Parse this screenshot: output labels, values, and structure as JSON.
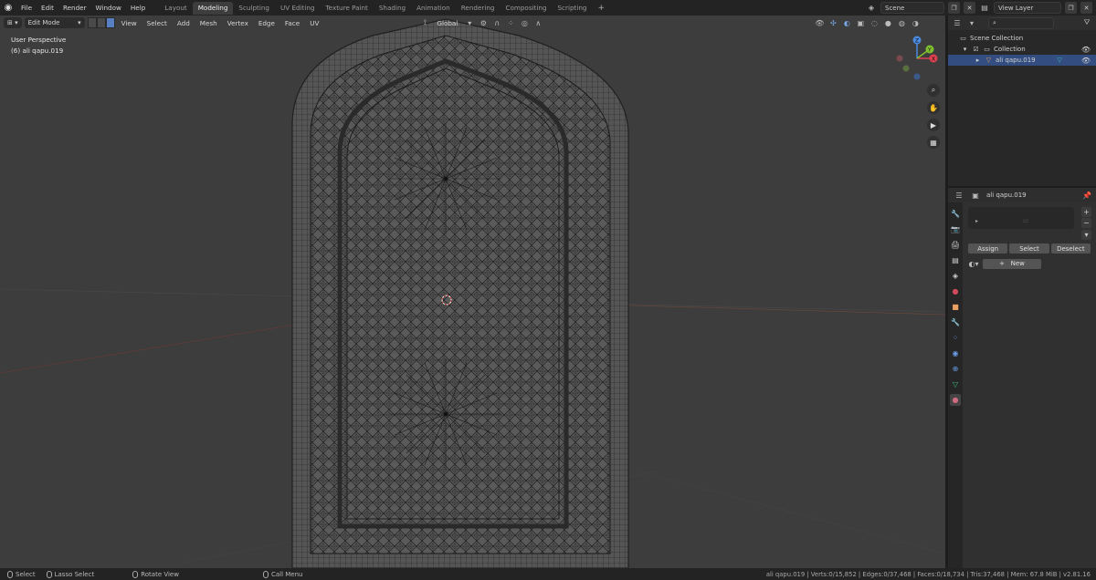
{
  "topbar": {
    "menus": [
      "File",
      "Edit",
      "Render",
      "Window",
      "Help"
    ],
    "workspaces": [
      "Layout",
      "Modeling",
      "Sculpting",
      "UV Editing",
      "Texture Paint",
      "Shading",
      "Animation",
      "Rendering",
      "Compositing",
      "Scripting"
    ],
    "active_workspace": "Modeling",
    "add_tab": "+",
    "scene": "Scene",
    "view_layer": "View Layer"
  },
  "viewport_header": {
    "mode": "Edit Mode",
    "menus": [
      "View",
      "Select",
      "Add",
      "Mesh",
      "Vertex",
      "Edge",
      "Face",
      "UV"
    ],
    "transform_orientation": "Global"
  },
  "viewport": {
    "perspective_label": "User Perspective",
    "object_label": "(6) ali qapu.019"
  },
  "gizmo": {
    "z": "Z",
    "y": "Y",
    "x": "X"
  },
  "outliner": {
    "search_placeholder": "",
    "scene_collection": "Scene Collection",
    "collection": "Collection",
    "object": "ali qapu.019"
  },
  "properties": {
    "object_name": "ali qapu.019",
    "slot_dots": ":::",
    "buttons": {
      "assign": "Assign",
      "select": "Select",
      "deselect": "Deselect",
      "new": "New"
    }
  },
  "statusbar": {
    "select": "Select",
    "lasso": "Lasso Select",
    "rotate": "Rotate View",
    "call_menu": "Call Menu",
    "stats": "ali qapu.019 | Verts:0/15,852 | Edges:0/37,468 | Faces:0/18,734 | Tris:37,468 | Mem: 67.8 MiB | v2.81.16"
  },
  "colors": {
    "selection_blue": "#334d80",
    "axis_x": "#e04050",
    "axis_y": "#80c030",
    "axis_z": "#4a8ae0",
    "accent": "#5680c2"
  }
}
